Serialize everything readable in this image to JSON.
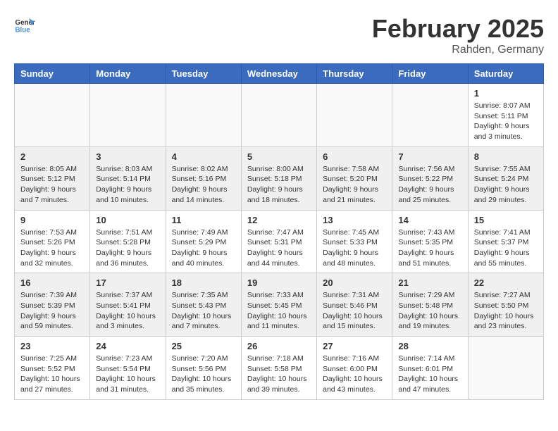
{
  "header": {
    "logo_general": "General",
    "logo_blue": "Blue",
    "month_title": "February 2025",
    "subtitle": "Rahden, Germany"
  },
  "weekdays": [
    "Sunday",
    "Monday",
    "Tuesday",
    "Wednesday",
    "Thursday",
    "Friday",
    "Saturday"
  ],
  "weeks": [
    [
      {
        "day": "",
        "info": ""
      },
      {
        "day": "",
        "info": ""
      },
      {
        "day": "",
        "info": ""
      },
      {
        "day": "",
        "info": ""
      },
      {
        "day": "",
        "info": ""
      },
      {
        "day": "",
        "info": ""
      },
      {
        "day": "1",
        "info": "Sunrise: 8:07 AM\nSunset: 5:11 PM\nDaylight: 9 hours and 3 minutes."
      }
    ],
    [
      {
        "day": "2",
        "info": "Sunrise: 8:05 AM\nSunset: 5:12 PM\nDaylight: 9 hours and 7 minutes."
      },
      {
        "day": "3",
        "info": "Sunrise: 8:03 AM\nSunset: 5:14 PM\nDaylight: 9 hours and 10 minutes."
      },
      {
        "day": "4",
        "info": "Sunrise: 8:02 AM\nSunset: 5:16 PM\nDaylight: 9 hours and 14 minutes."
      },
      {
        "day": "5",
        "info": "Sunrise: 8:00 AM\nSunset: 5:18 PM\nDaylight: 9 hours and 18 minutes."
      },
      {
        "day": "6",
        "info": "Sunrise: 7:58 AM\nSunset: 5:20 PM\nDaylight: 9 hours and 21 minutes."
      },
      {
        "day": "7",
        "info": "Sunrise: 7:56 AM\nSunset: 5:22 PM\nDaylight: 9 hours and 25 minutes."
      },
      {
        "day": "8",
        "info": "Sunrise: 7:55 AM\nSunset: 5:24 PM\nDaylight: 9 hours and 29 minutes."
      }
    ],
    [
      {
        "day": "9",
        "info": "Sunrise: 7:53 AM\nSunset: 5:26 PM\nDaylight: 9 hours and 32 minutes."
      },
      {
        "day": "10",
        "info": "Sunrise: 7:51 AM\nSunset: 5:28 PM\nDaylight: 9 hours and 36 minutes."
      },
      {
        "day": "11",
        "info": "Sunrise: 7:49 AM\nSunset: 5:29 PM\nDaylight: 9 hours and 40 minutes."
      },
      {
        "day": "12",
        "info": "Sunrise: 7:47 AM\nSunset: 5:31 PM\nDaylight: 9 hours and 44 minutes."
      },
      {
        "day": "13",
        "info": "Sunrise: 7:45 AM\nSunset: 5:33 PM\nDaylight: 9 hours and 48 minutes."
      },
      {
        "day": "14",
        "info": "Sunrise: 7:43 AM\nSunset: 5:35 PM\nDaylight: 9 hours and 51 minutes."
      },
      {
        "day": "15",
        "info": "Sunrise: 7:41 AM\nSunset: 5:37 PM\nDaylight: 9 hours and 55 minutes."
      }
    ],
    [
      {
        "day": "16",
        "info": "Sunrise: 7:39 AM\nSunset: 5:39 PM\nDaylight: 9 hours and 59 minutes."
      },
      {
        "day": "17",
        "info": "Sunrise: 7:37 AM\nSunset: 5:41 PM\nDaylight: 10 hours and 3 minutes."
      },
      {
        "day": "18",
        "info": "Sunrise: 7:35 AM\nSunset: 5:43 PM\nDaylight: 10 hours and 7 minutes."
      },
      {
        "day": "19",
        "info": "Sunrise: 7:33 AM\nSunset: 5:45 PM\nDaylight: 10 hours and 11 minutes."
      },
      {
        "day": "20",
        "info": "Sunrise: 7:31 AM\nSunset: 5:46 PM\nDaylight: 10 hours and 15 minutes."
      },
      {
        "day": "21",
        "info": "Sunrise: 7:29 AM\nSunset: 5:48 PM\nDaylight: 10 hours and 19 minutes."
      },
      {
        "day": "22",
        "info": "Sunrise: 7:27 AM\nSunset: 5:50 PM\nDaylight: 10 hours and 23 minutes."
      }
    ],
    [
      {
        "day": "23",
        "info": "Sunrise: 7:25 AM\nSunset: 5:52 PM\nDaylight: 10 hours and 27 minutes."
      },
      {
        "day": "24",
        "info": "Sunrise: 7:23 AM\nSunset: 5:54 PM\nDaylight: 10 hours and 31 minutes."
      },
      {
        "day": "25",
        "info": "Sunrise: 7:20 AM\nSunset: 5:56 PM\nDaylight: 10 hours and 35 minutes."
      },
      {
        "day": "26",
        "info": "Sunrise: 7:18 AM\nSunset: 5:58 PM\nDaylight: 10 hours and 39 minutes."
      },
      {
        "day": "27",
        "info": "Sunrise: 7:16 AM\nSunset: 6:00 PM\nDaylight: 10 hours and 43 minutes."
      },
      {
        "day": "28",
        "info": "Sunrise: 7:14 AM\nSunset: 6:01 PM\nDaylight: 10 hours and 47 minutes."
      },
      {
        "day": "",
        "info": ""
      }
    ]
  ]
}
